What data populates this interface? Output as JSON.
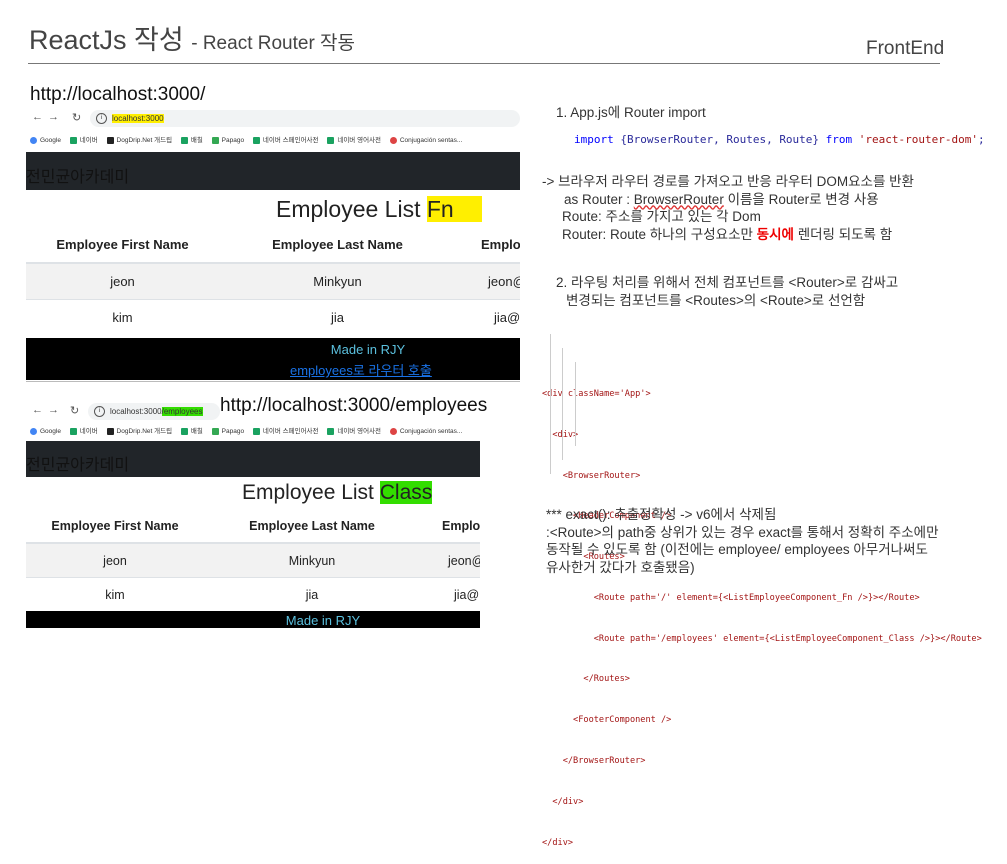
{
  "header": {
    "title": "ReactJs 작성",
    "subtitle": "- React Router 작동",
    "section": "FrontEnd"
  },
  "screen1": {
    "url_label": "http://localhost:3000/",
    "address": "localhost:3000",
    "bookmarks": [
      "Google",
      "네이버",
      "DogDrip.Net 개드립",
      "배칠",
      "Papago",
      "네이버 스페인어사전",
      "네이버 영어사전",
      "Conjugación sentas..."
    ],
    "app_brand": "전민균아카데미",
    "list_title": "Employee List",
    "list_suffix": "Fn",
    "columns": [
      "Employee First Name",
      "Employee Last Name",
      "Emplo"
    ],
    "rows": [
      [
        "jeon",
        "Minkyun",
        "jeon@"
      ],
      [
        "kim",
        "jia",
        "jia@"
      ]
    ],
    "footer_text": "Made in RJY",
    "footer_link": "employees로 라우터 호출"
  },
  "screen2": {
    "url_label": "http://localhost:3000/employees",
    "address_host": "localhost:3000",
    "address_path": "/employees",
    "bookmarks": [
      "Google",
      "네이버",
      "DogDrip.Net 개드립",
      "배칠",
      "Papago",
      "네이버 스페인어사전",
      "네이버 영어사전",
      "Conjugación sentas..."
    ],
    "app_brand": "전민균아카데미",
    "list_title": "Employee List",
    "list_suffix": "Class",
    "columns": [
      "Employee First Name",
      "Employee Last Name",
      "Emplo"
    ],
    "rows": [
      [
        "jeon",
        "Minkyun",
        "jeon@"
      ],
      [
        "kim",
        "jia",
        "jia@"
      ]
    ],
    "footer_text": "Made in RJY"
  },
  "notes": {
    "step1": "1.      App.js에 Router import",
    "import_code": {
      "kw_import": "import",
      "names": " {BrowserRouter, Routes, Route} ",
      "kw_from": "from",
      "module": " 'react-router-dom'",
      "end": ";"
    },
    "explain": {
      "l1": "-> 브라우저 라우터 경로를 가져오고 반응 라우터 DOM요소를 반환",
      "l2a": "as Router : ",
      "l2b": "BrowserRouter",
      "l2c": " 이름을 Router로 변경 사용",
      "l3": "Route: 주소를 가지고 있는 각 Dom",
      "l4a": "Router: Route 하나의 구성요소만 ",
      "l4b": "동시에",
      "l4c": " 렌더링 되도록 함"
    },
    "step2_l1": "2.      라우팅 처리를 위해서 전체 컴포넌트를 <Router>로 감싸고",
    "step2_l2": "변경되는 컴포넌트를 <Routes>의 <Route>로 선언함",
    "xml_lines": [
      "<div className='App'>",
      "  <div>",
      "    <BrowserRouter>",
      "      <HeaderComponent />",
      "        <Routes>",
      "          <Route path='/' element={<ListEmployeeComponent_Fn />}></Route>",
      "          <Route path='/employees' element={<ListEmployeeComponent_Class />}></Route>",
      "        </Routes>",
      "      <FooterComponent />",
      "    </BrowserRouter>",
      "  </div>",
      "</div>"
    ],
    "exact_l1": "*** exact(): 추출정확성  -> v6에서 삭제됨",
    "exact_l2": ":<Route>의 path중 상위가 있는 경우 exact를 통해서 정확히 주소에만",
    "exact_l3": "동작될 수 있도록 함  (이전에는 employee/ employees 아무거나써도",
    "exact_l4": "유사한거 갔다가 호출됐음)"
  },
  "colors": {
    "highlight_yellow": "#ffef00",
    "highlight_green": "#33dd00",
    "app_header_bg": "#212529",
    "footer_text": "#5bc0de",
    "link": "#1a73e8",
    "emphasis_red": "#e00000"
  }
}
